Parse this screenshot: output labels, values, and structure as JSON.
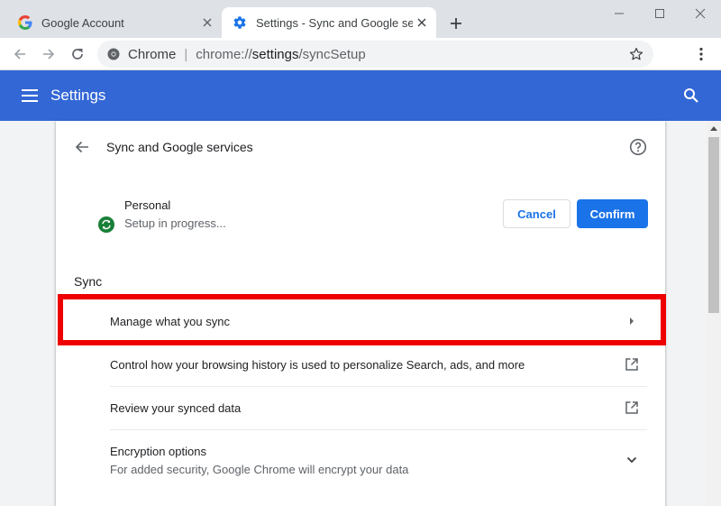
{
  "tabs": [
    {
      "title": "Google Account",
      "active": false
    },
    {
      "title": "Settings - Sync and Google services",
      "active": true
    }
  ],
  "toolbar": {
    "site_chip": "Chrome",
    "url_scheme": "chrome://",
    "url_host": "settings",
    "url_path": "/syncSetup"
  },
  "header": {
    "title": "Settings"
  },
  "page": {
    "title": "Sync and Google services",
    "account_name": "Personal",
    "account_status": "Setup in progress...",
    "cancel_label": "Cancel",
    "confirm_label": "Confirm",
    "sync_section_title": "Sync",
    "rows": [
      {
        "label": "Manage what you sync",
        "sublabel": "",
        "icon": "chevron-right-icon"
      },
      {
        "label": "Control how your browsing history is used to personalize Search, ads, and more",
        "sublabel": "",
        "icon": "external-link-icon"
      },
      {
        "label": "Review your synced data",
        "sublabel": "",
        "icon": "external-link-icon"
      },
      {
        "label": "Encryption options",
        "sublabel": "For added security, Google Chrome will encrypt your data",
        "icon": "chevron-down-icon"
      }
    ]
  },
  "colors": {
    "header_blue": "#3367d6",
    "primary_button": "#1a73e8",
    "sync_icon_green": "#188038",
    "highlight_red": "#ee0000"
  }
}
